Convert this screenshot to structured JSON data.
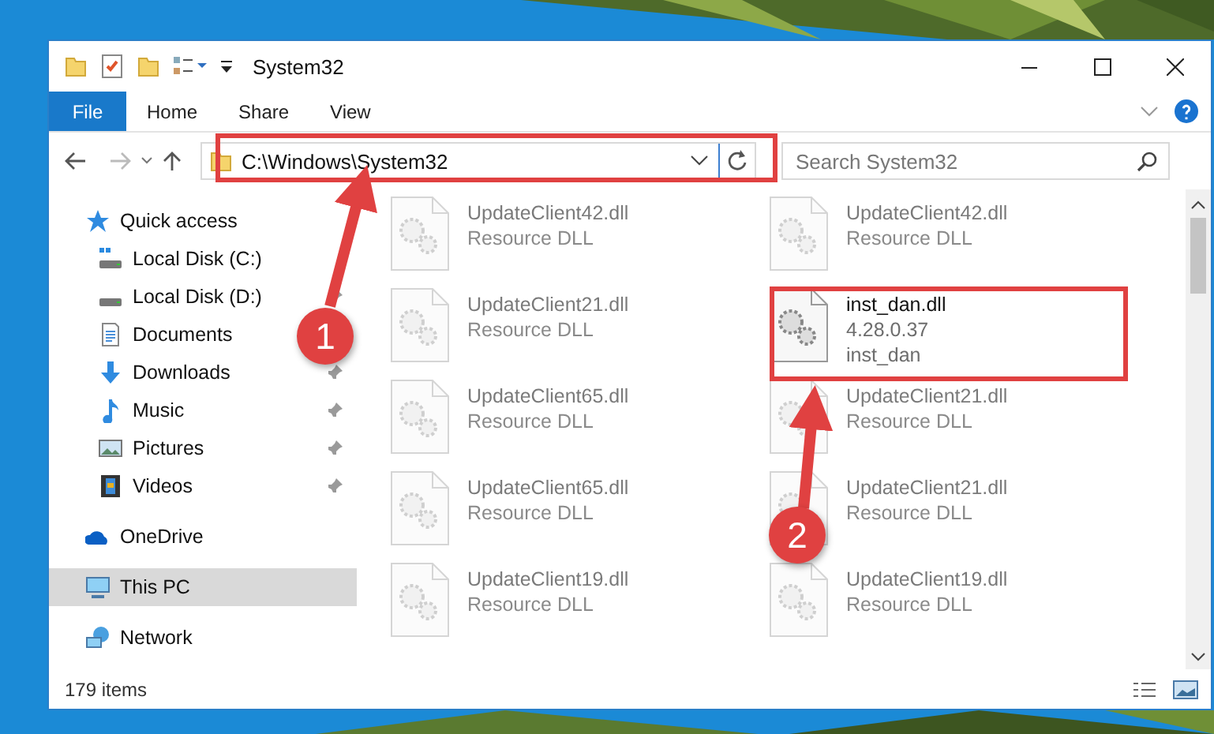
{
  "window": {
    "title": "System32"
  },
  "ribbon": {
    "tabs": [
      {
        "label": "File",
        "selected": true
      },
      {
        "label": "Home",
        "selected": false
      },
      {
        "label": "Share",
        "selected": false
      },
      {
        "label": "View",
        "selected": false
      }
    ]
  },
  "address": {
    "path": "C:\\Windows\\System32"
  },
  "search": {
    "placeholder": "Search System32"
  },
  "nav": [
    {
      "label": "Quick access",
      "selected": false,
      "children": [
        {
          "label": "Local Disk (C:)",
          "pinned": false,
          "selected": false
        },
        {
          "label": "Local Disk (D:)",
          "pinned": true,
          "selected": false
        },
        {
          "label": "Documents",
          "selected": false
        },
        {
          "label": "Downloads",
          "pinned": true,
          "selected": false
        },
        {
          "label": "Music",
          "pinned": true,
          "selected": false
        },
        {
          "label": "Pictures",
          "pinned": true,
          "selected": false
        },
        {
          "label": "Videos",
          "pinned": true,
          "selected": false
        }
      ]
    },
    {
      "label": "OneDrive",
      "selected": false
    },
    {
      "label": "This PC",
      "selected": true
    },
    {
      "label": "Network",
      "selected": false
    }
  ],
  "files": [
    {
      "name": "UpdateClient42.dll",
      "details": [
        "Resource DLL"
      ],
      "blurred": true
    },
    {
      "name": "UpdateClient42.dll",
      "details": [
        "Resource DLL"
      ],
      "blurred": true
    },
    {
      "name": "UpdateClient21.dll",
      "details": [
        "Resource DLL"
      ],
      "blurred": true
    },
    {
      "name": "inst_dan.dll",
      "details": [
        "4.28.0.37",
        "inst_dan"
      ],
      "blurred": false
    },
    {
      "name": "UpdateClient65.dll",
      "details": [
        "Resource DLL"
      ],
      "blurred": true
    },
    {
      "name": "UpdateClient21.dll",
      "details": [
        "Resource DLL"
      ],
      "blurred": true
    },
    {
      "name": "UpdateClient65.dll",
      "details": [
        "Resource DLL"
      ],
      "blurred": true
    },
    {
      "name": "UpdateClient21.dll",
      "details": [
        "Resource DLL"
      ],
      "blurred": true
    },
    {
      "name": "UpdateClient19.dll",
      "details": [
        "Resource DLL"
      ],
      "blurred": true
    },
    {
      "name": "UpdateClient19.dll",
      "details": [
        "Resource DLL"
      ],
      "blurred": true
    }
  ],
  "status_bar": {
    "item_count": "179 items"
  },
  "annotations": [
    {
      "label": "1"
    },
    {
      "label": "2"
    }
  ]
}
